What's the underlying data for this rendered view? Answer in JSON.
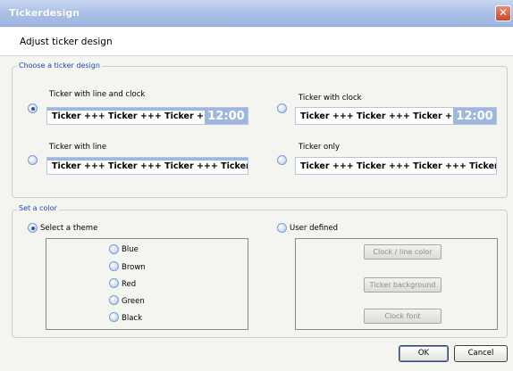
{
  "window": {
    "title": "Tickerdesign",
    "close_glyph": "✕"
  },
  "header": {
    "title": "Adjust ticker design"
  },
  "design_group": {
    "legend": "Choose a ticker design",
    "options": [
      {
        "label": "Ticker with line and clock",
        "checked": true,
        "preview_text": "Ticker +++ Ticker +++ Ticker +++ T",
        "clock": "12:00",
        "line": true
      },
      {
        "label": "Ticker with clock",
        "checked": false,
        "preview_text": "Ticker +++ Ticker +++ Ticker +++ T",
        "clock": "12:00",
        "line": false
      },
      {
        "label": "Ticker with line",
        "checked": false,
        "preview_text": "Ticker +++ Ticker +++ Ticker +++ Ticker +++",
        "line": true
      },
      {
        "label": "Ticker only",
        "checked": false,
        "preview_text": "Ticker +++ Ticker +++ Ticker +++ Ticker +++",
        "line": false
      }
    ]
  },
  "color_group": {
    "legend": "Set a color",
    "theme_option": {
      "label": "Select a theme",
      "checked": true
    },
    "themes": [
      {
        "label": "Blue"
      },
      {
        "label": "Brown"
      },
      {
        "label": "Red"
      },
      {
        "label": "Green"
      },
      {
        "label": "Black"
      }
    ],
    "user_option": {
      "label": "User defined",
      "checked": false
    },
    "user_buttons": {
      "clock_line": "Clock / line color",
      "background": "Ticker background",
      "font": "Clock font"
    }
  },
  "footer": {
    "ok": "OK",
    "cancel": "Cancel"
  },
  "colors": {
    "accent": "#9fb7dc",
    "legend": "#1a47b8",
    "title_bar": "#a9bfe6"
  }
}
